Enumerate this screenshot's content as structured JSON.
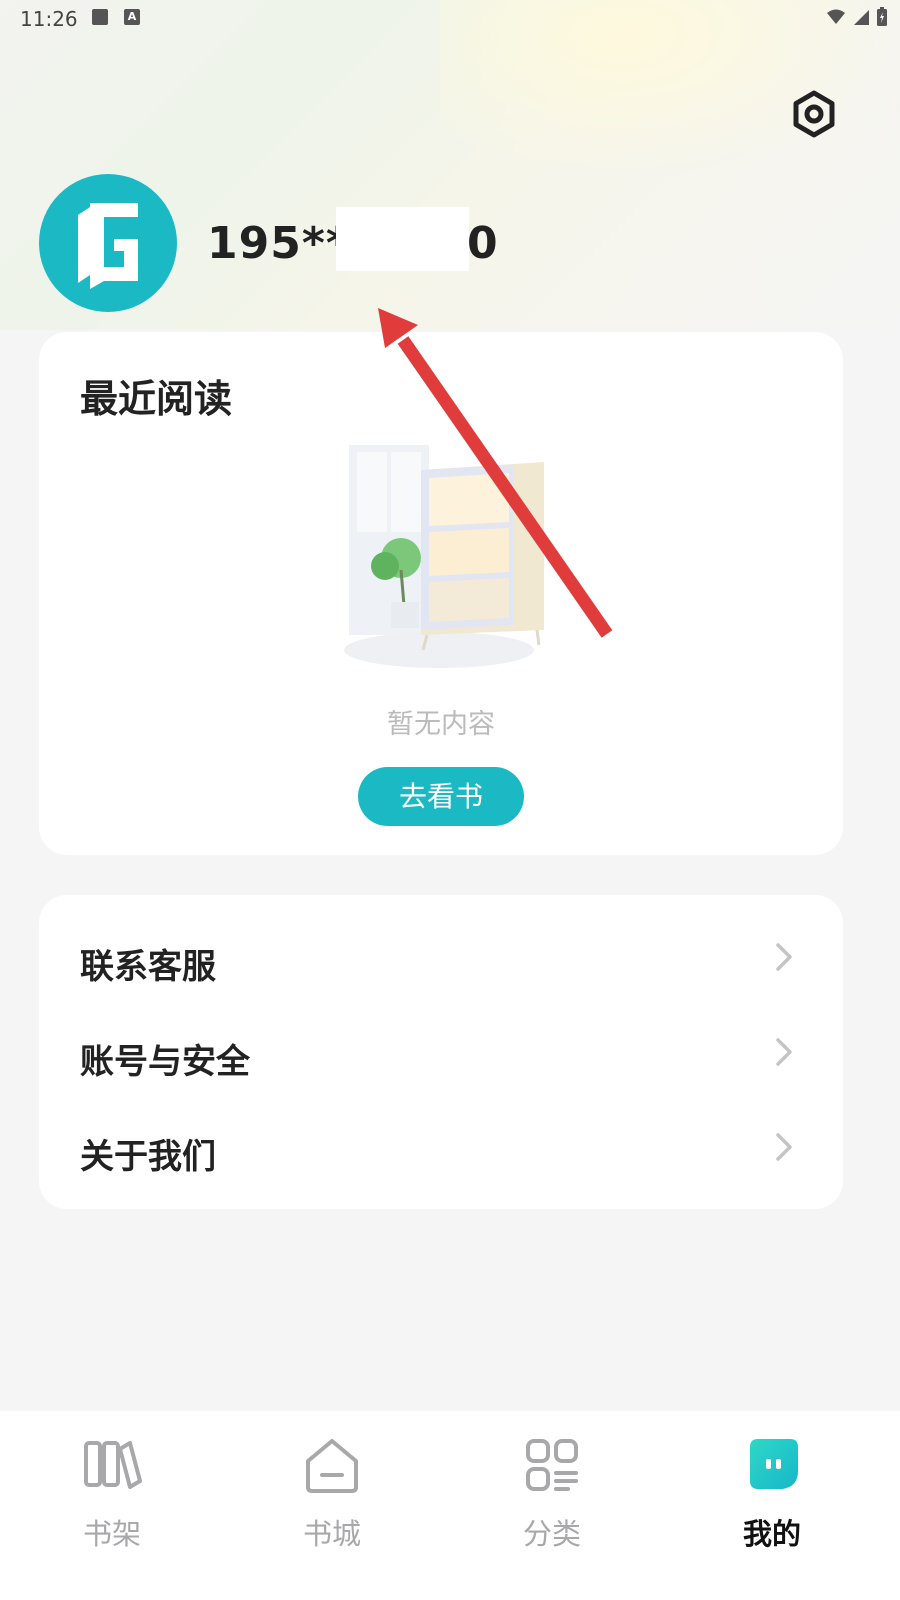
{
  "status_bar": {
    "time": "11:26"
  },
  "profile": {
    "username_visible": "195**",
    "username_tail": "0"
  },
  "recent_reading": {
    "title": "最近阅读",
    "empty_text": "暂无内容",
    "button_label": "去看书"
  },
  "menu": {
    "items": [
      {
        "label": "联系客服"
      },
      {
        "label": "账号与安全"
      },
      {
        "label": "关于我们"
      }
    ]
  },
  "bottom_nav": {
    "items": [
      {
        "label": "书架",
        "icon": "bookshelf-icon",
        "active": false
      },
      {
        "label": "书城",
        "icon": "bookstore-icon",
        "active": false
      },
      {
        "label": "分类",
        "icon": "category-icon",
        "active": false
      },
      {
        "label": "我的",
        "icon": "profile-icon",
        "active": true
      }
    ]
  },
  "colors": {
    "accent": "#1bb9c4",
    "annotation_arrow": "#e03c3c",
    "inactive_nav": "#a8a8ab",
    "active_nav": "#111111"
  }
}
